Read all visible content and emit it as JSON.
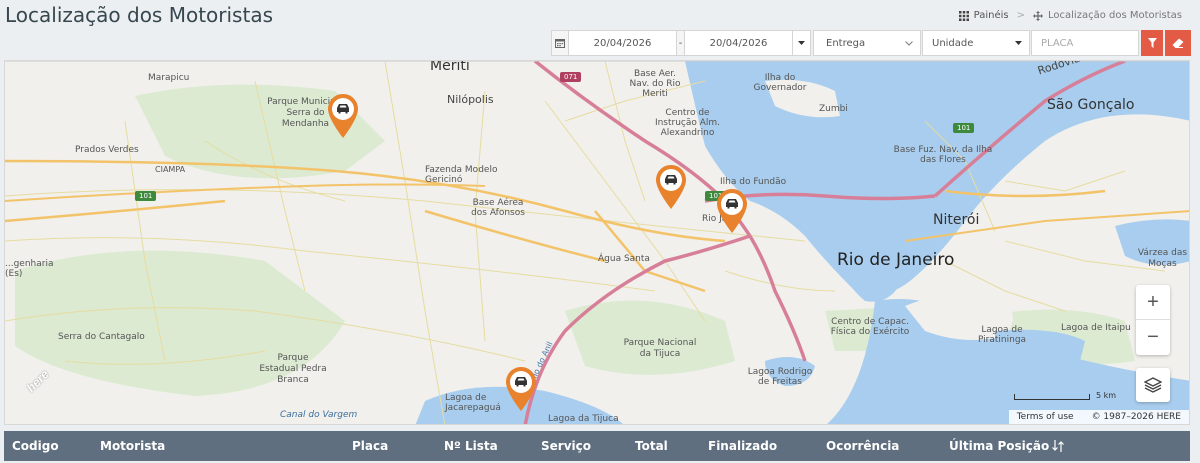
{
  "header": {
    "title": "Localização dos Motoristas",
    "breadcrumb": {
      "home": "Painéis",
      "current": "Localização dos Motoristas"
    }
  },
  "filters": {
    "date_start": "20/04/2026",
    "date_separator": "-",
    "date_end": "20/04/2026",
    "service": "Entrega",
    "unit": "Unidade",
    "plate_placeholder": "PLACA"
  },
  "map": {
    "labels": {
      "meriti": "Meriti",
      "nilopolis": "Nilópolis",
      "marapicu": "Marapicu",
      "parque_mendanha": "Parque Municipal Serra do Mendanha",
      "prados_verdes": "Prados Verdes",
      "ciampa": "CIAMPA",
      "fazenda": "Fazenda Modelo Gericinó",
      "base_afonsos": "Base Aérea dos Afonsos",
      "agua_santa": "Água Santa",
      "centro_instrucao": "Centro de Instrução Alm. Alexandrino",
      "ilha_governador": "Ilha do Governador",
      "zumbi": "Zumbi",
      "base_rio": "Base Aer. Nav. do Rio Meriti",
      "sao_goncalo": "São Gonçalo",
      "base_fuz": "Base Fuz. Nav. da Ilha das Flores",
      "ilha_fundao": "Ilha do Fundão",
      "rio_janeiro_small": "Rio Ja...",
      "niteroi": "Niterói",
      "rio_de_janeiro": "Rio de Janeiro",
      "varzea": "Várzea das Moças",
      "gengenharia": "...genharia (Es)",
      "serra_cantagalo": "Serra do Cantagalo",
      "pedra_branca": "Parque Estadual Pedra Branca",
      "tijuca": "Parque Nacional da Tijuca",
      "centro_capac": "Centro de Capac. Física do Exército",
      "piratininga": "Lagoa de Piratininga",
      "itaipu": "Lagoa de Itaipu",
      "rodrigo": "Lagoa Rodrigo de Freitas",
      "jacarepagua": "Lagoa de Jacarepaguá",
      "lagoa_tijuca": "Lagoa da Tijuca",
      "canal_vargem": "Canal do Vargem",
      "rio_anil": "Rio do Anil",
      "rodovia": "Rodovia"
    },
    "highways": [
      "101",
      "071",
      "101",
      "101"
    ],
    "pins": [
      "driver-pin-1",
      "driver-pin-2",
      "driver-pin-3",
      "driver-pin-4"
    ],
    "scale_label": "5 km",
    "attribution": {
      "terms": "Terms of use",
      "copyright": "© 1987–2026 HERE"
    },
    "logo": "here",
    "zoom_in": "+",
    "zoom_out": "−"
  },
  "table": {
    "columns": [
      "Codigo",
      "Motorista",
      "Placa",
      "Nº Lista",
      "Serviço",
      "Total",
      "Finalizado",
      "Ocorrência",
      "Última Posição"
    ]
  },
  "colors": {
    "accent": "#e35a45",
    "pin": "#e8822c",
    "header_bg": "#5f6f7f",
    "water": "#a8cdee"
  }
}
